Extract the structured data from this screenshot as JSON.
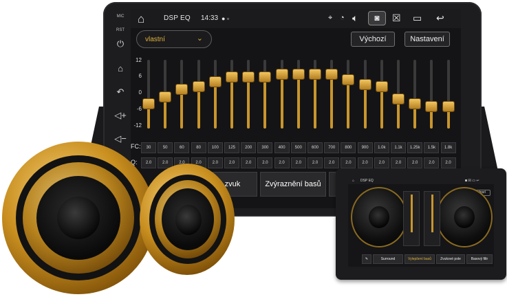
{
  "side_buttons": {
    "mic": "MIC",
    "rst": "RST"
  },
  "status": {
    "app_title": "DSP EQ",
    "time": "14:33",
    "icons": [
      "home-icon",
      "location-icon",
      "wifi-icon",
      "volume-icon",
      "camera-icon",
      "close-window-icon",
      "window-icon",
      "back-icon"
    ]
  },
  "toolbar": {
    "preset_value": "vlastní",
    "default_label": "Výchozí",
    "settings_label": "Nastavení"
  },
  "eq": {
    "db_labels": [
      "12",
      "6",
      "0",
      "-6",
      "-12"
    ],
    "range_db": [
      -12,
      12
    ],
    "band_gains": [
      -4,
      -1,
      2,
      3,
      5,
      7,
      7,
      7,
      8,
      8,
      8,
      8,
      6,
      4,
      3,
      -2,
      -4,
      -5,
      -5
    ],
    "fc_label": "FC:",
    "fc_values": [
      "30",
      "50",
      "60",
      "80",
      "100",
      "125",
      "200",
      "300",
      "400",
      "500",
      "600",
      "700",
      "800",
      "900",
      "1.0k",
      "1.1k",
      "1.25k",
      "1.5k",
      "1.8k"
    ],
    "q_label": "Q:",
    "q_values": [
      "2.0",
      "2.0",
      "2.0",
      "2.0",
      "2.0",
      "2.0",
      "2.0",
      "2.0",
      "2.0",
      "2.0",
      "2.0",
      "2.0",
      "2.0",
      "2.0",
      "2.0",
      "2.0",
      "2.0",
      "2.0",
      "2.0"
    ]
  },
  "modes": {
    "surround_partial": "rový zvuk",
    "bass_boost": "Zvýraznění basů"
  },
  "mini": {
    "title": "DSP EQ",
    "default_label": "Výchozí",
    "modes": [
      "Surround",
      "Vylepšení basů",
      "Zvukové pole",
      "Basový filtr"
    ],
    "active_mode": "Vylepšení basů"
  },
  "colors": {
    "accent": "#e0b23b",
    "slider_gold": "#c9952c",
    "screen_bg": "#141416"
  }
}
